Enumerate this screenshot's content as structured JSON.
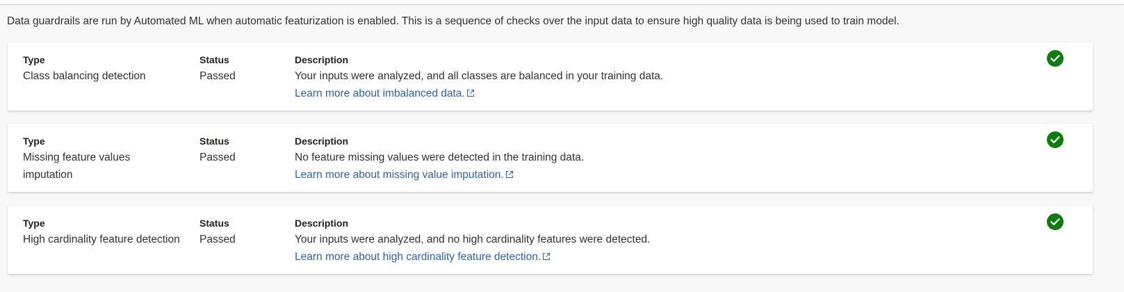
{
  "intro_text": "Data guardrails are run by Automated ML when automatic featurization is enabled. This is a sequence of checks over the input data to ensure high quality data is being used to train model.",
  "column_headers": {
    "type": "Type",
    "status": "Status",
    "description": "Description"
  },
  "guardrails": [
    {
      "type": "Class balancing detection",
      "status": "Passed",
      "description": "Your inputs were analyzed, and all classes are balanced in your training data.",
      "link_text": "Learn more about imbalanced data.",
      "status_icon": "check-circle-icon"
    },
    {
      "type": "Missing feature values imputation",
      "status": "Passed",
      "description": "No feature missing values were detected in the training data.",
      "link_text": "Learn more about missing value imputation.",
      "status_icon": "check-circle-icon"
    },
    {
      "type": "High cardinality feature detection",
      "status": "Passed",
      "description": "Your inputs were analyzed, and no high cardinality features were detected.",
      "link_text": "Learn more about high cardinality feature detection.",
      "status_icon": "check-circle-icon"
    }
  ],
  "colors": {
    "passed_green": "#107c10",
    "link_blue": "#2b62b8"
  }
}
